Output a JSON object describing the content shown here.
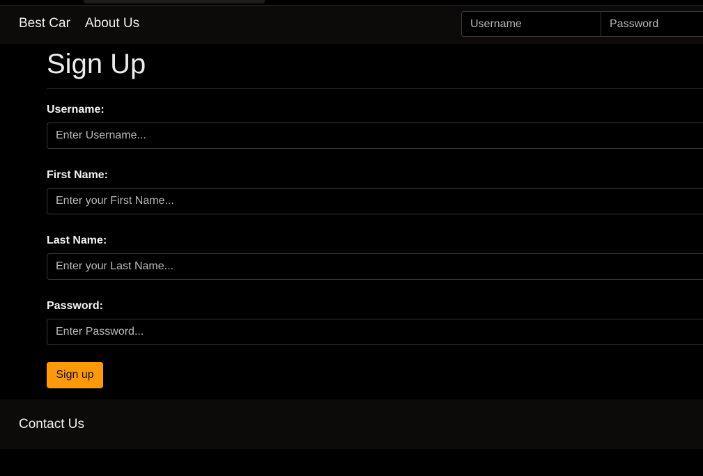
{
  "navbar": {
    "brand": "Best Car",
    "about": "About Us",
    "username_placeholder": "Username",
    "password_placeholder": "Password"
  },
  "form": {
    "title": "Sign Up",
    "fields": [
      {
        "label": "Username:",
        "placeholder": "Enter Username..."
      },
      {
        "label": "First Name:",
        "placeholder": "Enter your First Name..."
      },
      {
        "label": "Last Name:",
        "placeholder": "Enter your Last Name..."
      },
      {
        "label": "Password:",
        "placeholder": "Enter Password..."
      }
    ],
    "submit_label": "Sign up"
  },
  "footer": {
    "contact": "Contact Us"
  },
  "colors": {
    "accent": "#ff9908",
    "background": "#000000",
    "bar": "#0c0b0a"
  }
}
